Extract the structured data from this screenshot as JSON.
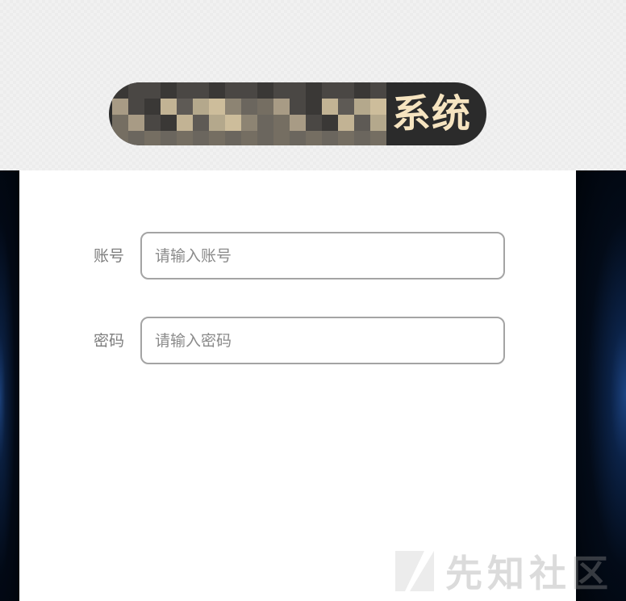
{
  "header": {
    "logo_text": "系统",
    "logo_text_color": "#f6e4c0",
    "logo_bg_color": "#2b2b2b"
  },
  "form": {
    "account": {
      "label": "账号",
      "placeholder": "请输入账号",
      "value": ""
    },
    "password": {
      "label": "密码",
      "placeholder": "请输入密码",
      "value": ""
    }
  },
  "watermark": {
    "text": "先知社区"
  }
}
